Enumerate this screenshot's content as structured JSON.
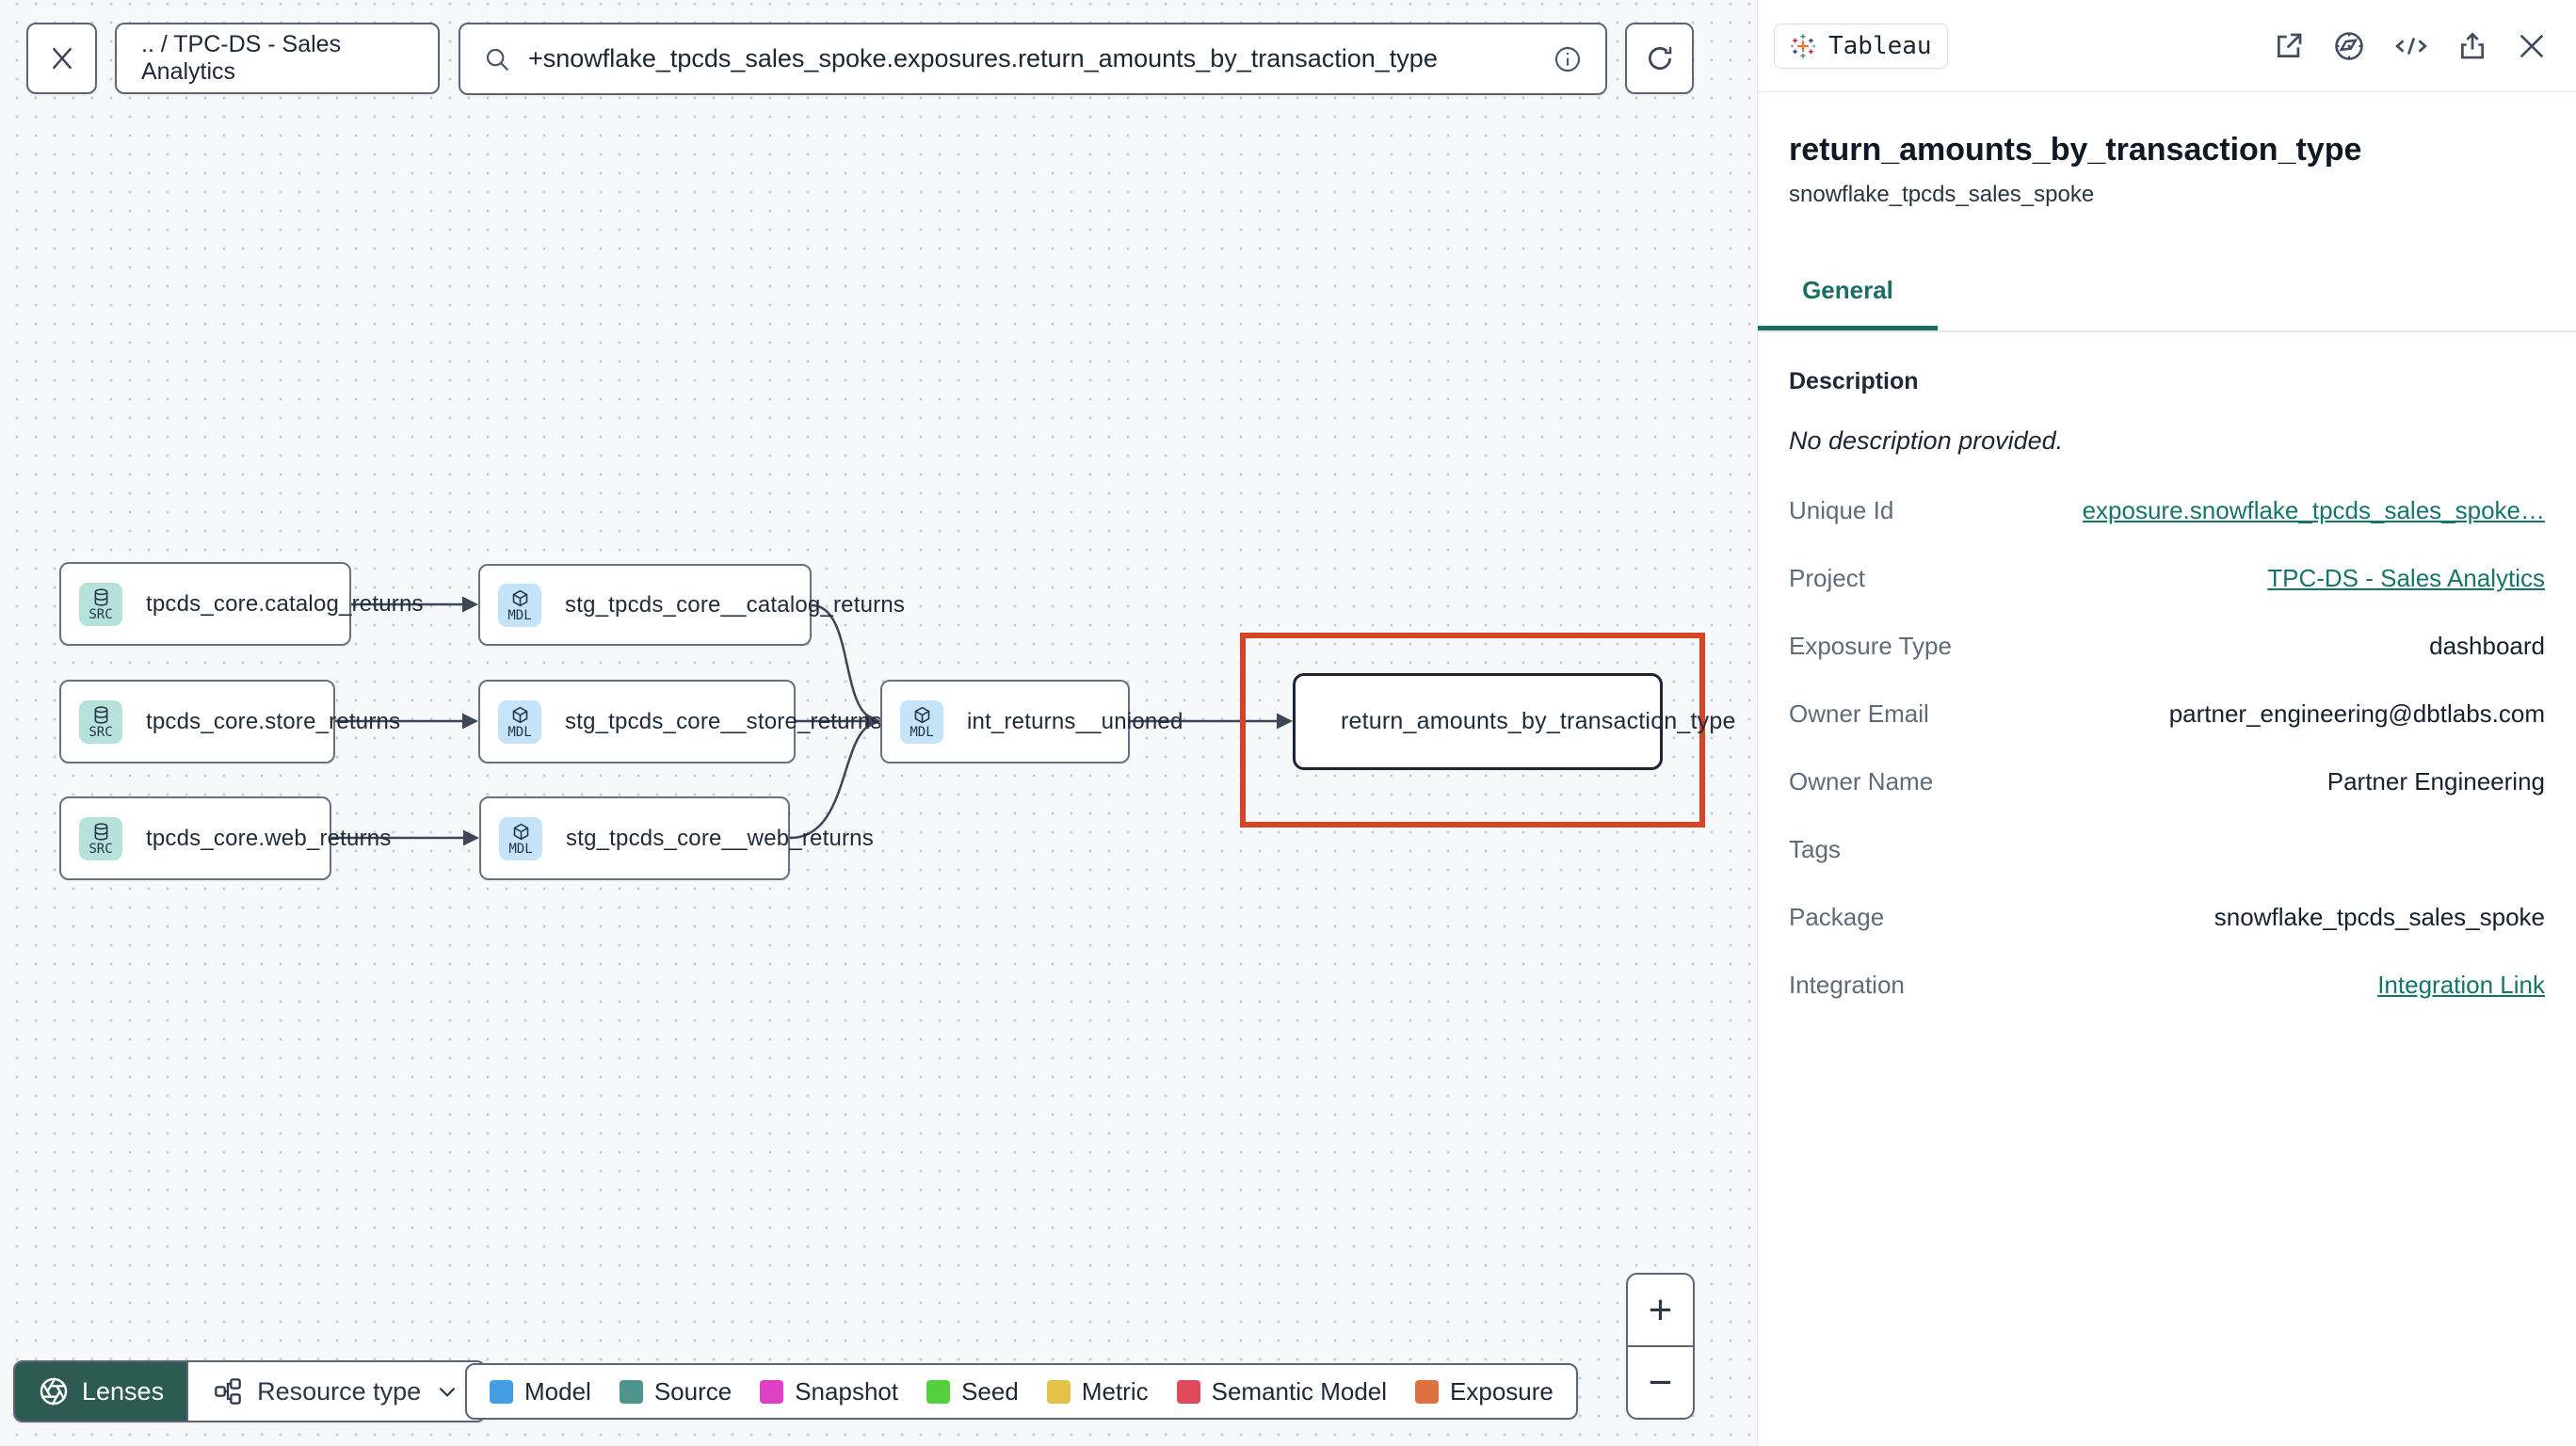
{
  "topbar": {
    "breadcrumb": ".. / TPC-DS - Sales Analytics",
    "search_value": "+snowflake_tpcds_sales_spoke.exposures.return_amounts_by_transaction_type"
  },
  "graph": {
    "nodes": [
      {
        "badge": "SRC",
        "label": "tpcds_core.catalog_returns"
      },
      {
        "badge": "SRC",
        "label": "tpcds_core.store_returns"
      },
      {
        "badge": "SRC",
        "label": "tpcds_core.web_returns"
      },
      {
        "badge": "MDL",
        "label": "stg_tpcds_core__catalog_returns"
      },
      {
        "badge": "MDL",
        "label": "stg_tpcds_core__store_returns"
      },
      {
        "badge": "MDL",
        "label": "stg_tpcds_core__web_returns"
      },
      {
        "badge": "MDL",
        "label": "int_returns__unioned"
      },
      {
        "badge": "tableau",
        "label": "return_amounts_by_transaction_type"
      }
    ]
  },
  "toolbar": {
    "lenses_label": "Lenses",
    "resource_type_label": "Resource type"
  },
  "legend": {
    "items": [
      {
        "label": "Model",
        "color": "#459ee3"
      },
      {
        "label": "Source",
        "color": "#4f938d"
      },
      {
        "label": "Snapshot",
        "color": "#dd40c2"
      },
      {
        "label": "Seed",
        "color": "#54cf3d"
      },
      {
        "label": "Metric",
        "color": "#e5c148"
      },
      {
        "label": "Semantic Model",
        "color": "#e0485c"
      },
      {
        "label": "Exposure",
        "color": "#dd7141"
      }
    ]
  },
  "zoom_controls": {
    "zoom_in": "+",
    "zoom_out": "−"
  },
  "panel": {
    "integration_badge": "Tableau",
    "title": "return_amounts_by_transaction_type",
    "subtitle": "snowflake_tpcds_sales_spoke",
    "tab": "General",
    "description_label": "Description",
    "description_empty": "No description provided.",
    "fields": [
      {
        "label": "Unique Id",
        "value": "exposure.snowflake_tpcds_sales_spoke…"
      },
      {
        "label": "Project",
        "value": "TPC-DS - Sales Analytics"
      },
      {
        "label": "Exposure Type",
        "value": "dashboard"
      },
      {
        "label": "Owner Email",
        "value": "partner_engineering@dbtlabs.com"
      },
      {
        "label": "Owner Name",
        "value": "Partner Engineering"
      },
      {
        "label": "Tags",
        "value": ""
      },
      {
        "label": "Package",
        "value": "snowflake_tpcds_sales_spoke"
      },
      {
        "label": "Integration",
        "value": "Integration Link"
      }
    ],
    "accent_color": "#1a6f64",
    "highlight_color": "#d64426"
  }
}
